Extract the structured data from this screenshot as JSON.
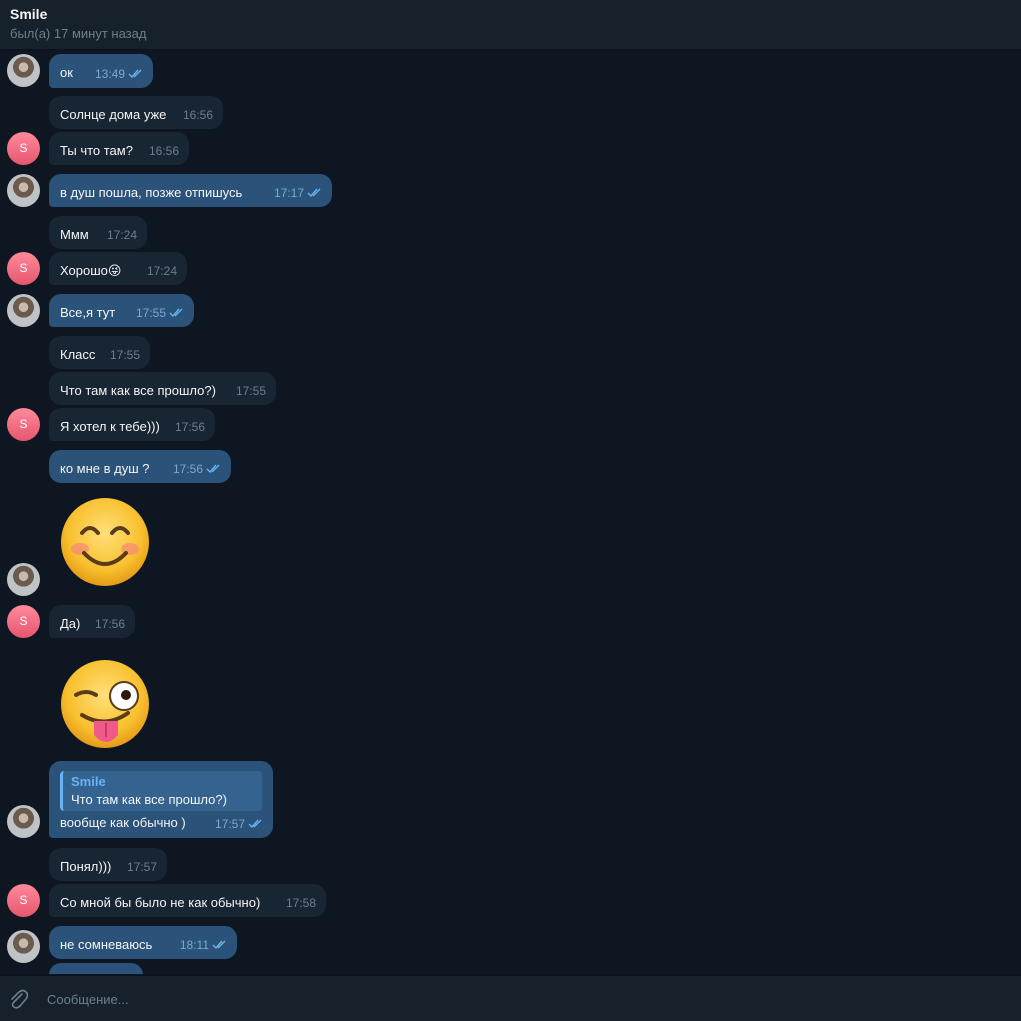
{
  "header": {
    "title": "Smile",
    "status": "был(а) 17 минут назад"
  },
  "composer": {
    "placeholder": "Сообщение...",
    "attach_icon": "paperclip-icon"
  },
  "colors": {
    "background": "#0e1621",
    "incoming_bubble": "#182533",
    "outgoing_bubble": "#2b5278",
    "accent": "#6ab3f3"
  },
  "messages": [
    {
      "dir": "out",
      "text": "ок",
      "time": "13:49",
      "read": true
    },
    {
      "dir": "in",
      "text": "Солнце дома уже",
      "time": "16:56"
    },
    {
      "dir": "in",
      "text": "Ты что там?",
      "time": "16:56"
    },
    {
      "dir": "out",
      "text": "в душ пошла, позже отпишусь",
      "time": "17:17",
      "read": true
    },
    {
      "dir": "in",
      "text": "Ммм",
      "time": "17:24"
    },
    {
      "dir": "in",
      "text": "Хорошо",
      "emoji": "😜",
      "time": "17:24"
    },
    {
      "dir": "out",
      "text": "Все,я тут",
      "time": "17:55",
      "read": true
    },
    {
      "dir": "in",
      "text": "Класс",
      "time": "17:55"
    },
    {
      "dir": "in",
      "text": "Что там как все прошло?)",
      "time": "17:55"
    },
    {
      "dir": "in",
      "text": "Я хотел к тебе)))",
      "time": "17:56"
    },
    {
      "dir": "out",
      "text": "ко мне в душ ?",
      "time": "17:56",
      "read": true
    },
    {
      "dir": "out",
      "sticker": "😊"
    },
    {
      "dir": "in",
      "text": "Да)",
      "time": "17:56"
    },
    {
      "dir": "in",
      "sticker": "😜"
    },
    {
      "dir": "out",
      "reply_name": "Smile",
      "reply_text": "Что там как все прошло?)",
      "text": "вообще как обычно )",
      "time": "17:57",
      "read": true
    },
    {
      "dir": "in",
      "text": "Понял)))",
      "time": "17:57"
    },
    {
      "dir": "in",
      "text": "Со мной бы было не как обычно)",
      "time": "17:58"
    },
    {
      "dir": "out",
      "text": "не сомневаюсь",
      "time": "18:11",
      "read": true
    }
  ],
  "avatars": {
    "contact_initial": "S"
  }
}
